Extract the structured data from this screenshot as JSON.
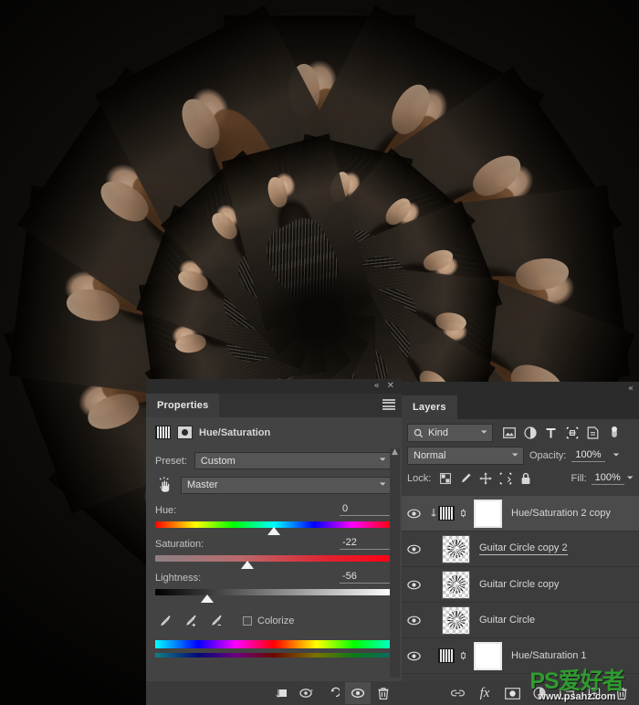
{
  "app": "Adobe Photoshop",
  "canvas": {
    "name": "artwork-canvas",
    "description": "Radial kaleidoscope repeat of a model holding a guitar"
  },
  "properties_panel": {
    "tab_label": "Properties",
    "collapse_icon": "«",
    "close_icon": "✕",
    "menu_icon": "panel-menu-icon",
    "adjustment_title": "Hue/Saturation",
    "preset_label": "Preset:",
    "preset_value": "Custom",
    "channel_value": "Master",
    "sliders": [
      {
        "label": "Hue:",
        "value": "0",
        "thumb_pct": 50,
        "track": "hue"
      },
      {
        "label": "Saturation:",
        "value": "-22",
        "thumb_pct": 39,
        "track": "sat"
      },
      {
        "label": "Lightness:",
        "value": "-56",
        "thumb_pct": 22,
        "track": "light"
      }
    ],
    "eyedroppers": [
      "eyedropper",
      "eyedropper-add",
      "eyedropper-subtract"
    ],
    "colorize_label": "Colorize",
    "colorize_checked": false,
    "footer_buttons": [
      "clip-to-layer",
      "view-previous-state",
      "reset",
      "toggle-visibility",
      "delete-layer"
    ]
  },
  "layers_panel": {
    "collapse_icon": "«",
    "tab_label": "Layers",
    "kind_label": "Kind",
    "filter_icons": [
      "pixel-layers-filter",
      "adjustment-layers-filter",
      "type-layers-filter",
      "shape-layers-filter",
      "smart-object-filter"
    ],
    "blend_mode": "Normal",
    "opacity_label": "Opacity:",
    "opacity_value": "100%",
    "lock_label": "Lock:",
    "lock_icons": [
      "lock-transparent-pixels",
      "lock-image-pixels",
      "lock-position",
      "lock-artboard-nesting",
      "lock-all"
    ],
    "fill_label": "Fill:",
    "fill_value": "100%",
    "layers": [
      {
        "name": "Hue/Saturation 2 copy",
        "visible": true,
        "selected": true,
        "type": "adjustment",
        "clipped": true,
        "has_mask": true,
        "renaming": false
      },
      {
        "name": "Guitar Circle copy 2",
        "visible": true,
        "selected": false,
        "type": "pixel",
        "clipped": false,
        "has_mask": false,
        "renaming": true
      },
      {
        "name": "Guitar Circle copy",
        "visible": true,
        "selected": false,
        "type": "pixel",
        "clipped": false,
        "has_mask": false,
        "renaming": false
      },
      {
        "name": "Guitar Circle",
        "visible": true,
        "selected": false,
        "type": "pixel",
        "clipped": false,
        "has_mask": false,
        "renaming": false
      },
      {
        "name": "Hue/Saturation 1",
        "visible": true,
        "selected": false,
        "type": "adjustment",
        "clipped": false,
        "has_mask": true,
        "renaming": false
      }
    ],
    "footer_buttons": [
      "link-layers",
      "add-layer-style",
      "add-layer-mask",
      "new-adjustment-layer",
      "new-group",
      "new-layer",
      "delete-layer"
    ]
  },
  "watermark": {
    "main": "PS爱好者",
    "sub": "www.psahz.com",
    "color": "#2f9b2f"
  },
  "colors": {
    "panel_bg": "#3c3c3c",
    "panel_bg_alt": "#434343",
    "tabbar": "#2b2b2b",
    "text": "#d8d8d8",
    "selected_row": "#4b4b4b"
  }
}
